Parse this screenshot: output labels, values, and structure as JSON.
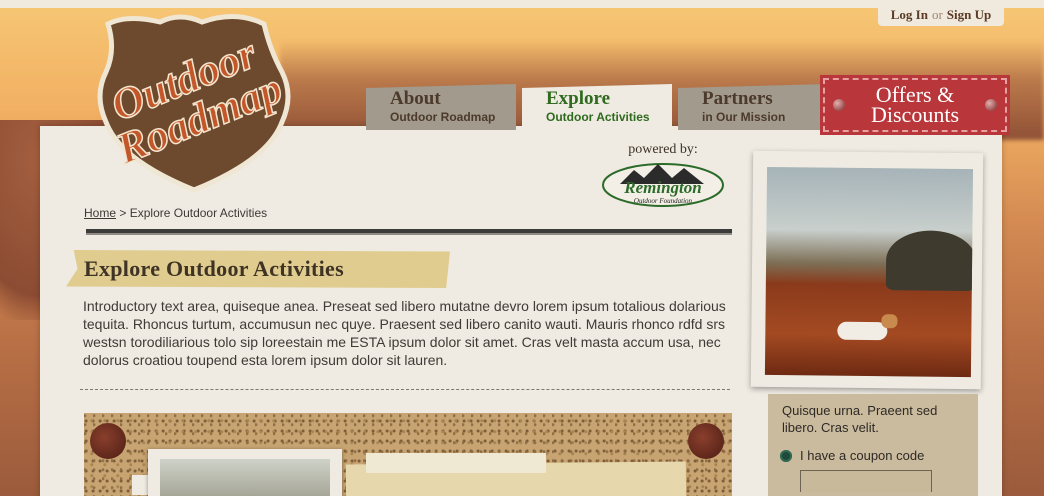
{
  "auth": {
    "login": "Log In",
    "or": "or",
    "signup": "Sign Up"
  },
  "logo": {
    "line1": "Outdoor",
    "line2": "Roadmap",
    "brand_color": "#6d4a2e",
    "text_color": "#c4572a"
  },
  "tabs": [
    {
      "title": "About",
      "subtitle": "Outdoor Roadmap",
      "active": false
    },
    {
      "title": "Explore",
      "subtitle": "Outdoor Activities",
      "active": true
    },
    {
      "title": "Partners",
      "subtitle": "in Our Mission",
      "active": false
    }
  ],
  "offers": {
    "label": "Offers & Discounts",
    "color": "#b9373a"
  },
  "powered": {
    "caption": "powered by:",
    "partner_logo_text": "Remington",
    "partner_logo_sub": "Outdoor Foundation"
  },
  "breadcrumb": {
    "home": "Home",
    "separator": ">",
    "current": "Explore Outdoor Activities"
  },
  "page": {
    "heading": "Explore Outdoor Activities",
    "intro": "Introductory text area, quiseque anea. Preseat sed libero mutatne devro lorem ipsum totalious dolarious tequita. Rhoncus turtum, accumusun nec quye. Praesent sed libero canito wauti. Mauris rhonco rdfd srs westsn torodiliarious tolo sip loreestain me  ESTA ipsum dolor sit amet. Cras velt masta accum usa, nec dolorus croatiou toupend esta lorem ipsum dolor sit lauren."
  },
  "sidebar": {
    "text": "Quisque urna. Praeent sed libero. Cras velit.",
    "coupon_label": "I have a coupon code",
    "coupon_value": ""
  },
  "colors": {
    "active_tab_text": "#2f6b1e",
    "paper": "#efebe3"
  }
}
